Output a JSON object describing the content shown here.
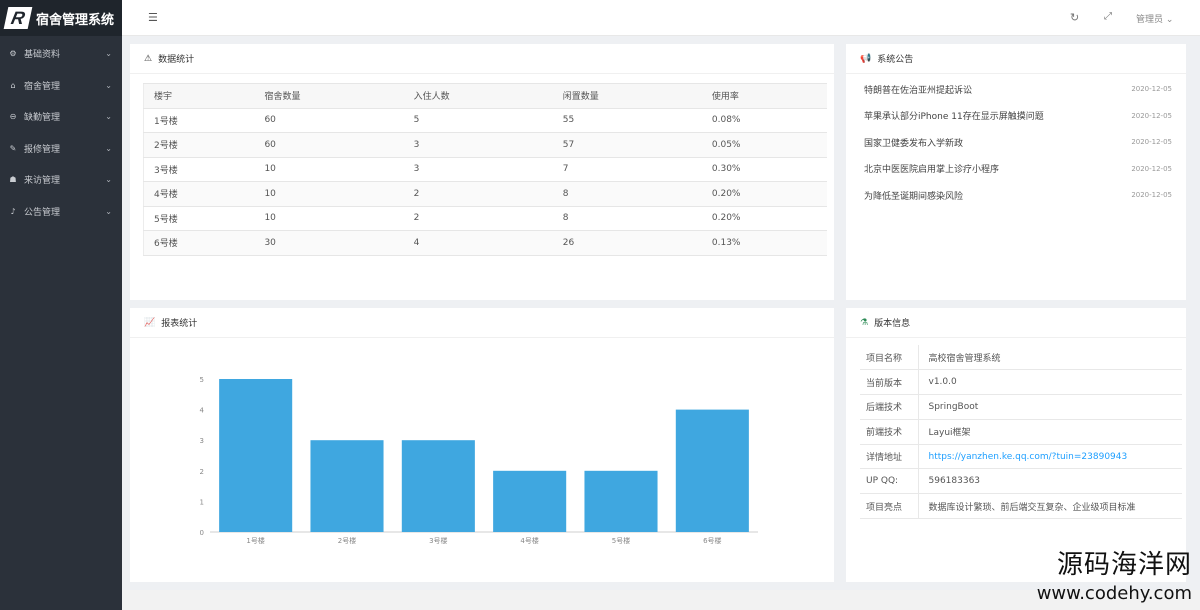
{
  "app": {
    "logo_letter": "R",
    "title": "宿舍管理系统"
  },
  "sidebar": {
    "items": [
      {
        "label": "基础资料",
        "icon": "gear-icon"
      },
      {
        "label": "宿舍管理",
        "icon": "home-icon"
      },
      {
        "label": "缺勤管理",
        "icon": "minus-circle-icon"
      },
      {
        "label": "报修管理",
        "icon": "wrench-icon"
      },
      {
        "label": "来访管理",
        "icon": "visitor-icon"
      },
      {
        "label": "公告管理",
        "icon": "bell-icon"
      }
    ]
  },
  "topbar": {
    "user_label": "管理员"
  },
  "stats_card": {
    "title": "数据统计",
    "headers": [
      "楼宇",
      "宿舍数量",
      "入住人数",
      "闲置数量",
      "使用率"
    ],
    "rows": [
      [
        "1号楼",
        "60",
        "5",
        "55",
        "0.08%"
      ],
      [
        "2号楼",
        "60",
        "3",
        "57",
        "0.05%"
      ],
      [
        "3号楼",
        "10",
        "3",
        "7",
        "0.30%"
      ],
      [
        "4号楼",
        "10",
        "2",
        "8",
        "0.20%"
      ],
      [
        "5号楼",
        "10",
        "2",
        "8",
        "0.20%"
      ],
      [
        "6号楼",
        "30",
        "4",
        "26",
        "0.13%"
      ]
    ]
  },
  "notice_card": {
    "title": "系统公告",
    "items": [
      {
        "text": "特朗普在佐治亚州提起诉讼",
        "date": "2020-12-05"
      },
      {
        "text": "苹果承认部分iPhone 11存在显示屏触摸问题",
        "date": "2020-12-05"
      },
      {
        "text": "国家卫健委发布入学新政",
        "date": "2020-12-05"
      },
      {
        "text": "北京中医医院启用掌上诊疗小程序",
        "date": "2020-12-05"
      },
      {
        "text": "为降低圣诞期间感染风险",
        "date": "2020-12-05"
      }
    ]
  },
  "chart_card": {
    "title": "报表统计"
  },
  "chart_data": {
    "type": "bar",
    "categories": [
      "1号楼",
      "2号楼",
      "3号楼",
      "4号楼",
      "5号楼",
      "6号楼"
    ],
    "values": [
      5,
      3,
      3,
      2,
      2,
      4
    ],
    "ylim": [
      0,
      5
    ],
    "yticks": [
      0,
      1,
      2,
      3,
      4,
      5
    ],
    "color": "#3fa7e0",
    "grid": false
  },
  "version_card": {
    "title": "版本信息",
    "rows": [
      {
        "key": "项目名称",
        "value": "高校宿舍管理系统"
      },
      {
        "key": "当前版本",
        "value": "v1.0.0"
      },
      {
        "key": "后端技术",
        "value": "SpringBoot"
      },
      {
        "key": "前端技术",
        "value": "Layui框架"
      },
      {
        "key": "详情地址",
        "value": "https://yanzhen.ke.qq.com/?tuin=23890943",
        "link": true
      },
      {
        "key": "UP QQ:",
        "value": "596183363"
      },
      {
        "key": "项目亮点",
        "value": "数据库设计繁琐、前后端交互复杂、企业级项目标准"
      }
    ]
  },
  "watermark": {
    "line1": "源码海洋网",
    "line2": "www.codehy.com"
  }
}
